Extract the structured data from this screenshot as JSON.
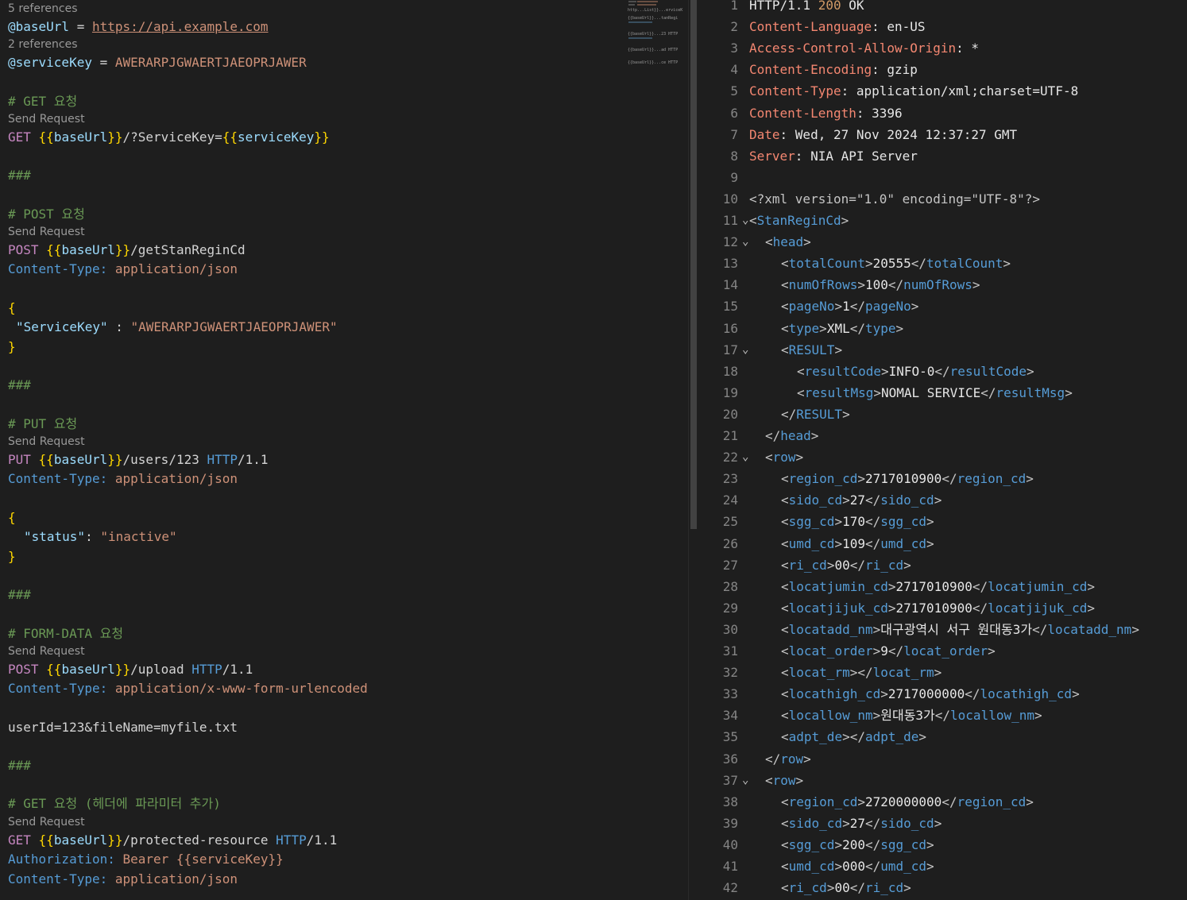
{
  "left": {
    "codelens": {
      "refs_base": "5 references",
      "refs_key": "2 references",
      "send": "Send Request"
    },
    "vars": {
      "base_name": "@baseUrl",
      "base_eq": " = ",
      "base_val": "https://api.example.com",
      "key_name": "@serviceKey",
      "key_eq": " = ",
      "key_val": "AWERARPJGWAERTJAEOPRJAWER"
    },
    "blocks": {
      "get_comment": "# GET 요청",
      "get_method": "GET",
      "get_path": "/?ServiceKey=",
      "sep": "###",
      "post_comment": "# POST 요청",
      "post_method": "POST",
      "post_path": "/getStanReginCd",
      "ct_label": "Content-Type:",
      "ct_json": " application/json",
      "post_body_key": "\"ServiceKey\"",
      "post_body_colon": " : ",
      "post_body_val": "\"AWERARPJGWAERTJAEOPRJAWER\"",
      "put_comment": "# PUT 요청",
      "put_method": "PUT",
      "put_path": "/users/123 ",
      "http": "HTTP",
      "http_ver": "/1.1",
      "put_body_key": "\"status\"",
      "put_body_colon": ": ",
      "put_body_val": "\"inactive\"",
      "form_comment": "# FORM-DATA 요청",
      "form_method": "POST",
      "form_path": "/upload ",
      "ct_form": " application/x-www-form-urlencoded",
      "form_body": "userId=123&fileName=myfile.txt",
      "hdr_comment": "# GET 요청 (헤더에 파라미터 추가)",
      "hdr_method": "GET",
      "hdr_path": "/protected-resource ",
      "auth_label": "Authorization:",
      "auth_val": " Bearer {{serviceKey}}",
      "var_base": "baseUrl",
      "var_key": "serviceKey",
      "open_brace": "{",
      "close_brace": "}",
      "dbl_open": "{{",
      "dbl_close": "}}"
    }
  },
  "minimap": {
    "l1": "http...List}}...erviceK",
    "l2": "{{baseUrl}}...tanRegi",
    "l3": "{{baseUrl}}...23 HTTP",
    "l4": "{{baseUrl}}...ad HTTP",
    "l5": "{{baseUrl}}...ce HTTP"
  },
  "response": {
    "lines": [
      {
        "n": "1",
        "k": "HTTP/1.1 ",
        "v2": "200",
        "v3": " OK"
      },
      {
        "n": "2",
        "hk": "Content-Language",
        "hv": ": en-US"
      },
      {
        "n": "3",
        "hk": "Access-Control-Allow-Origin",
        "hv": ": *"
      },
      {
        "n": "4",
        "hk": "Content-Encoding",
        "hv": ": gzip"
      },
      {
        "n": "5",
        "hk": "Content-Type",
        "hv": ": application/xml;charset=UTF-8"
      },
      {
        "n": "6",
        "hk": "Content-Length",
        "hv": ": 3396"
      },
      {
        "n": "7",
        "hk": "Date",
        "hv": ": Wed, 27 Nov 2024 12:37:27 GMT"
      },
      {
        "n": "8",
        "hk": "Server",
        "hv": ": NIA API Server"
      },
      {
        "n": "9"
      },
      {
        "n": "10",
        "xml": "<?xml version=\"1.0\" encoding=\"UTF-8\"?>"
      },
      {
        "n": "11",
        "tag": "StanReginCd",
        "fold": true,
        "depth": 0,
        "open": true
      },
      {
        "n": "12",
        "tag": "head",
        "fold": true,
        "depth": 1,
        "open": true
      },
      {
        "n": "13",
        "tag": "totalCount",
        "val": "20555",
        "depth": 2
      },
      {
        "n": "14",
        "tag": "numOfRows",
        "val": "100",
        "depth": 2
      },
      {
        "n": "15",
        "tag": "pageNo",
        "val": "1",
        "depth": 2
      },
      {
        "n": "16",
        "tag": "type",
        "val": "XML",
        "depth": 2
      },
      {
        "n": "17",
        "tag": "RESULT",
        "fold": true,
        "depth": 2,
        "open": true
      },
      {
        "n": "18",
        "tag": "resultCode",
        "val": "INFO-0",
        "depth": 3
      },
      {
        "n": "19",
        "tag": "resultMsg",
        "val": "NOMAL SERVICE",
        "depth": 3
      },
      {
        "n": "20",
        "tag": "RESULT",
        "depth": 2,
        "close": true
      },
      {
        "n": "21",
        "tag": "head",
        "depth": 1,
        "close": true
      },
      {
        "n": "22",
        "tag": "row",
        "fold": true,
        "depth": 1,
        "open": true
      },
      {
        "n": "23",
        "tag": "region_cd",
        "val": "2717010900",
        "depth": 2
      },
      {
        "n": "24",
        "tag": "sido_cd",
        "val": "27",
        "depth": 2
      },
      {
        "n": "25",
        "tag": "sgg_cd",
        "val": "170",
        "depth": 2
      },
      {
        "n": "26",
        "tag": "umd_cd",
        "val": "109",
        "depth": 2
      },
      {
        "n": "27",
        "tag": "ri_cd",
        "val": "00",
        "depth": 2
      },
      {
        "n": "28",
        "tag": "locatjumin_cd",
        "val": "2717010900",
        "depth": 2
      },
      {
        "n": "29",
        "tag": "locatjijuk_cd",
        "val": "2717010900",
        "depth": 2
      },
      {
        "n": "30",
        "tag": "locatadd_nm",
        "val": "대구광역시 서구 원대동3가",
        "depth": 2
      },
      {
        "n": "31",
        "tag": "locat_order",
        "val": "9",
        "depth": 2
      },
      {
        "n": "32",
        "tag": "locat_rm",
        "val": "",
        "depth": 2
      },
      {
        "n": "33",
        "tag": "locathigh_cd",
        "val": "2717000000",
        "depth": 2
      },
      {
        "n": "34",
        "tag": "locallow_nm",
        "val": "원대동3가",
        "depth": 2
      },
      {
        "n": "35",
        "tag": "adpt_de",
        "val": "",
        "depth": 2
      },
      {
        "n": "36",
        "tag": "row",
        "depth": 1,
        "close": true
      },
      {
        "n": "37",
        "tag": "row",
        "fold": true,
        "depth": 1,
        "open": true
      },
      {
        "n": "38",
        "tag": "region_cd",
        "val": "2720000000",
        "depth": 2
      },
      {
        "n": "39",
        "tag": "sido_cd",
        "val": "27",
        "depth": 2
      },
      {
        "n": "40",
        "tag": "sgg_cd",
        "val": "200",
        "depth": 2
      },
      {
        "n": "41",
        "tag": "umd_cd",
        "val": "000",
        "depth": 2
      },
      {
        "n": "42",
        "tag": "ri_cd",
        "val": "00",
        "depth": 2
      }
    ],
    "fold_icon": "⌄"
  }
}
